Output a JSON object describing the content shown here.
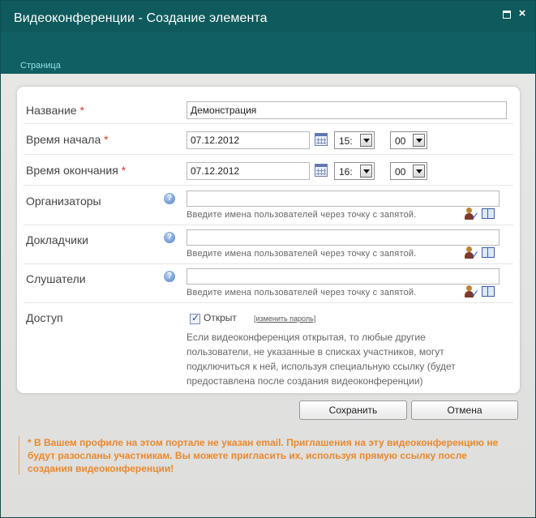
{
  "window": {
    "title": "Видеоконференции - Создание элемента"
  },
  "ribbon": {
    "tab_label": "Страница"
  },
  "form": {
    "required_mark": "*",
    "name": {
      "label": "Название",
      "value": "Демонстрация"
    },
    "start": {
      "label": "Время начала",
      "date": "07.12.2012",
      "hour": "15:",
      "minute": "00"
    },
    "end": {
      "label": "Время окончания",
      "date": "07.12.2012",
      "hour": "16:",
      "minute": "00"
    },
    "organizers": {
      "label": "Организаторы",
      "value": "",
      "hint": "Введите имена пользователей через точку с запятой."
    },
    "speakers": {
      "label": "Докладчики",
      "value": "",
      "hint": "Введите имена пользователей через точку с запятой."
    },
    "listeners": {
      "label": "Слушатели",
      "value": "",
      "hint": "Введите имена пользователей через точку с запятой."
    },
    "access": {
      "label": "Доступ",
      "checkbox_label": "Открыт",
      "checked": true,
      "change_password_link": "[изменить пароль]",
      "description": "Если видеоконференция открытая, то любые другие пользователи, не указанные в списках участников, могут подключиться к ней, используя специальную ссылку (будет предоставлена после создания видеоконференции)"
    }
  },
  "buttons": {
    "save": "Сохранить",
    "cancel": "Отмена"
  },
  "warning": {
    "text": "*   В Вашем профиле на этом портале не указан email. Приглашения на эту видеоконференцию не будут разосланы участникам. Вы можете пригласить их, используя прямую ссылку после создания видеоконференции!"
  },
  "colors": {
    "header": "#0f5a5d",
    "ribbon": "#105f62",
    "required": "#d83a2a",
    "warning": "#e8892f"
  }
}
